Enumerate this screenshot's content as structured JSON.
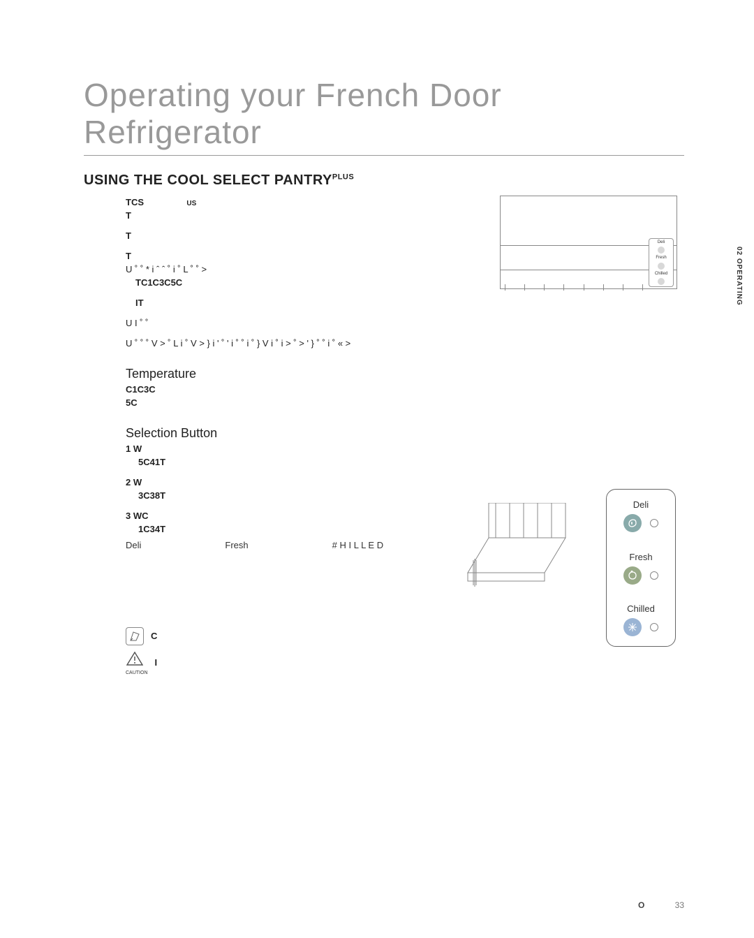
{
  "side_tab": "02 OPERATING",
  "title": "Operating your French Door Refrigerator",
  "section_heading": "USING THE COOL SELECT PANTRY",
  "section_sup": "PLUS",
  "intro": {
    "l1a": "TCS",
    "l1b": "US",
    "l2": "T",
    "l3": "T",
    "l4": "T",
    "l5": "U ˚ ˚  *  i ˆ ˆ ˚   i ˚ L      ˚      ˚  >",
    "l6": "TC1C3C5C",
    "l7": "ΙΤ",
    "l8": "U I ˚ ˚",
    "l9": "U ˚ ˚    ˚ V >  ˚ L i ˚ V  >  } i ' ˚ '  i ˚   ˚   i ˚ }    V i   ˚   i   >  ˚   > '   } ˚   ˚   i ˚ « >"
  },
  "temperature": {
    "heading": "Temperature",
    "l1": "C1C3C",
    "l2": "5C"
  },
  "selection": {
    "heading": "Selection Button",
    "i1a": "1  W",
    "i1b": "5C41T",
    "i2a": "2  W",
    "i2b": "3C38T",
    "i3a": "3  WC",
    "i3b": "1C34T"
  },
  "labels_row": {
    "a": "Deli",
    "b": "Fresh",
    "c": "# H I L L E D"
  },
  "panel": {
    "deli": "Deli",
    "fresh": "Fresh",
    "chilled": "Chilled"
  },
  "mini_panel": {
    "a": "Deli",
    "b": "Fresh",
    "c": "Chilled"
  },
  "notes": {
    "n1": "C",
    "n2": "I",
    "caution": "CAUTION"
  },
  "footer": {
    "label": "O",
    "page": "33"
  }
}
